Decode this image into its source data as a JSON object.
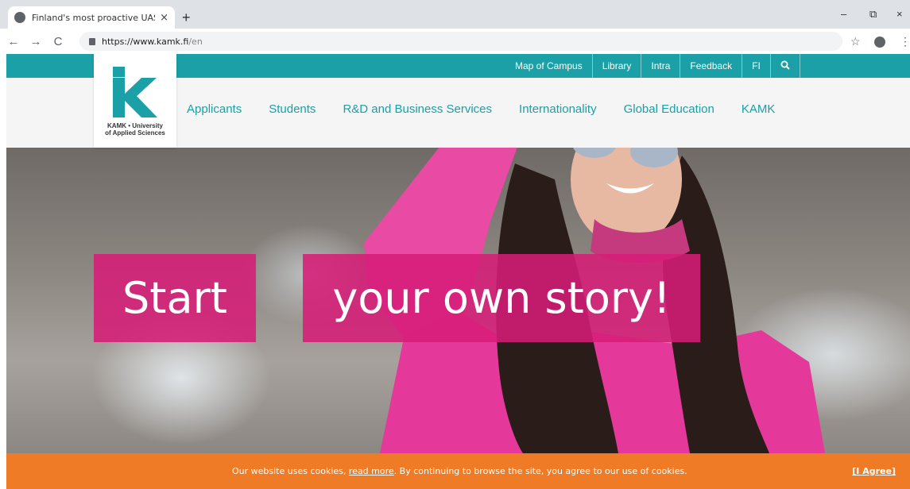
{
  "browser": {
    "tab_title": "Finland's most proactive UAS – K",
    "tab_close": "×",
    "new_tab": "+",
    "url_host": "https://www.kamk.fi",
    "url_path": "/en",
    "win_minimize": "–",
    "win_restore": "⧉",
    "win_close": "×",
    "back": "←",
    "forward": "→",
    "reload": "C",
    "bookmark": "☆",
    "menu": "⋮"
  },
  "site": {
    "top_links": [
      "Map of Campus",
      "Library",
      "Intra",
      "Feedback",
      "FI"
    ],
    "logo_text_line1": "KAMK • University",
    "logo_text_line2": "of Applied Sciences",
    "menu": [
      "Applicants",
      "Students",
      "R&D and Business Services",
      "Internationality",
      "Global Education",
      "KAMK"
    ],
    "brand_color": "#1aa0a6"
  },
  "hero": {
    "word1": "Start",
    "word2": "your own story!",
    "box_color": "#d61c78"
  },
  "cookie": {
    "before": "Our website uses cookies, ",
    "link": "read more",
    "after": ". By continuing to browse the site, you agree to our use of cookies.",
    "agree": "[I Agree]",
    "color": "#ef7b26"
  }
}
